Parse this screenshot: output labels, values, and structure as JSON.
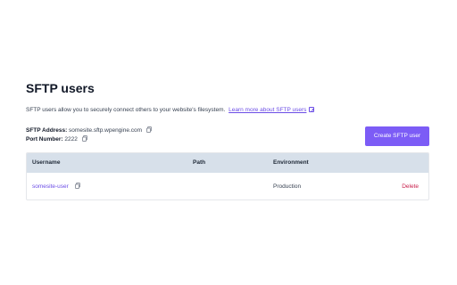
{
  "page": {
    "title": "SFTP users",
    "description": "SFTP users allow you to securely connect others to your website's filesystem.",
    "learn_more_link": "Learn more about SFTP users",
    "link_color": "#6b4de6"
  },
  "connection": {
    "address_label": "SFTP Address:",
    "address_value": "somesite.sftp.wpengine.com",
    "port_label": "Port Number:",
    "port_value": "2222"
  },
  "actions": {
    "create_label": "Create SFTP user",
    "create_color": "#7c5cf6"
  },
  "table": {
    "columns": [
      "Username",
      "Path",
      "Environment"
    ],
    "header_bg": "#d7e0ea",
    "rows": [
      {
        "username": "somesite-user",
        "path": "",
        "environment": "Production",
        "delete_label": "Delete"
      }
    ]
  },
  "icons": {
    "copy": "copy-icon",
    "external_link": "external-link-icon"
  }
}
